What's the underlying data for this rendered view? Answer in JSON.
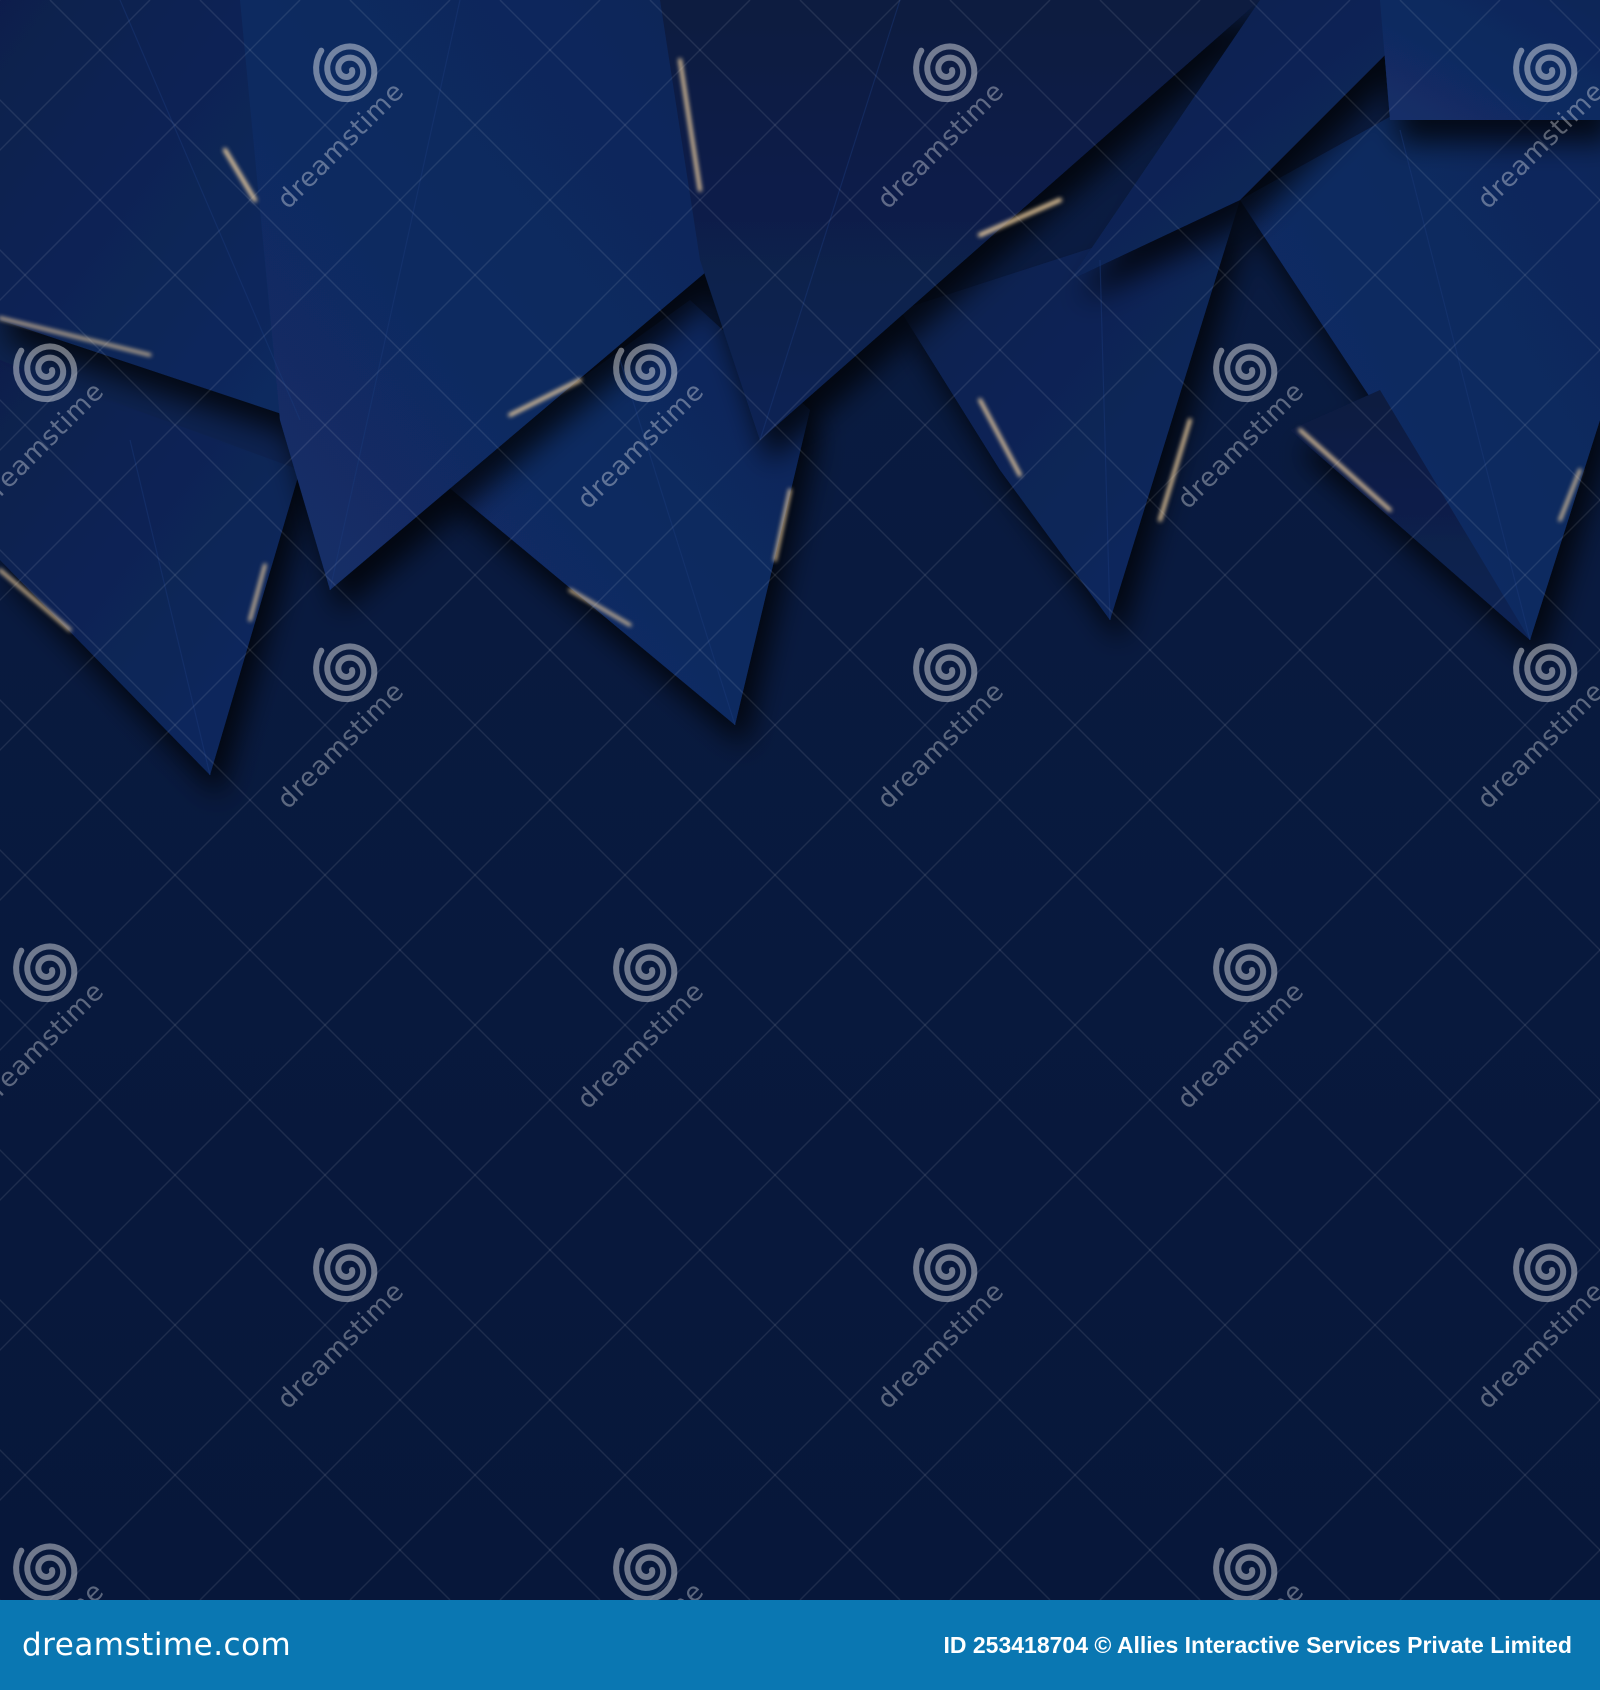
{
  "colors": {
    "background": "#08193a",
    "panel_dark": "#0a1f4a",
    "panel_mid": "#0f2a5e",
    "panel_light": "#142f6b",
    "gold_highlight": "#e9c38b",
    "footer_bar": "#0a77b2",
    "watermark": "#ffffff"
  },
  "watermark": {
    "word": "dreamstime",
    "icon": "spiral-logo-icon"
  },
  "footer": {
    "brand": "dreamstime.com",
    "credit": "ID 253418704 © Allies Interactive Services Private Limited"
  }
}
